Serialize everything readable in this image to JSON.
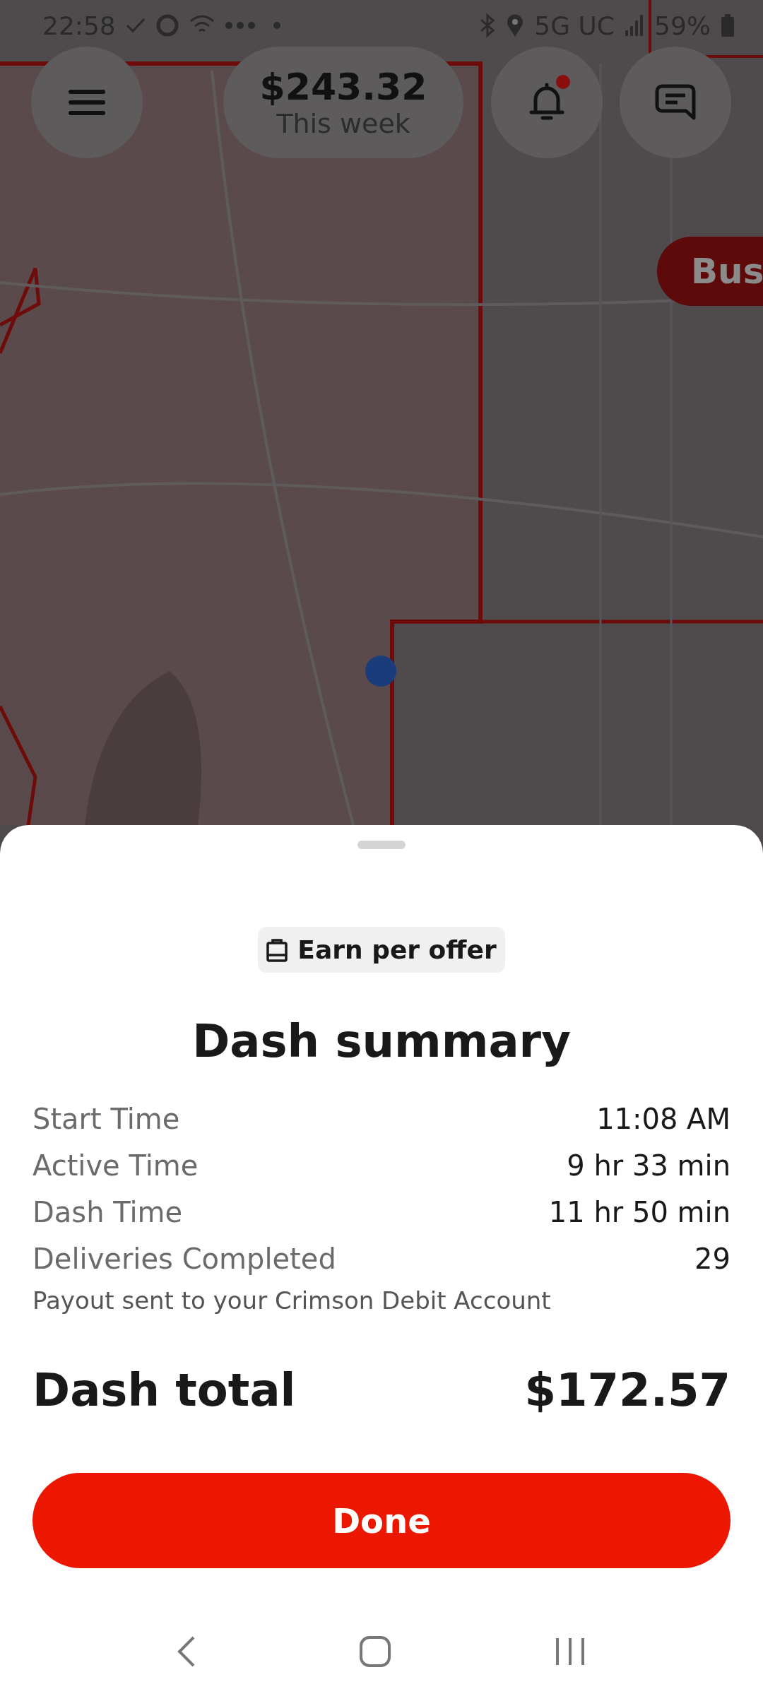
{
  "status_bar": {
    "time": "22:58",
    "network": "5G UC",
    "battery": "59%"
  },
  "map_overlay": {
    "earnings": {
      "amount": "$243.32",
      "period": "This week"
    },
    "notification_unread": true,
    "zone_badge": "Bus"
  },
  "sheet": {
    "pay_model": "Earn per offer",
    "title": "Dash summary",
    "rows": [
      {
        "label": "Start Time",
        "value": "11:08 AM"
      },
      {
        "label": "Active Time",
        "value": "9 hr 33 min"
      },
      {
        "label": "Dash Time",
        "value": "11 hr 50 min"
      },
      {
        "label": "Deliveries Completed",
        "value": "29"
      }
    ],
    "payout_note": "Payout sent to your Crimson Debit Account",
    "total_label": "Dash total",
    "total_value": "$172.57",
    "button": "Done"
  }
}
